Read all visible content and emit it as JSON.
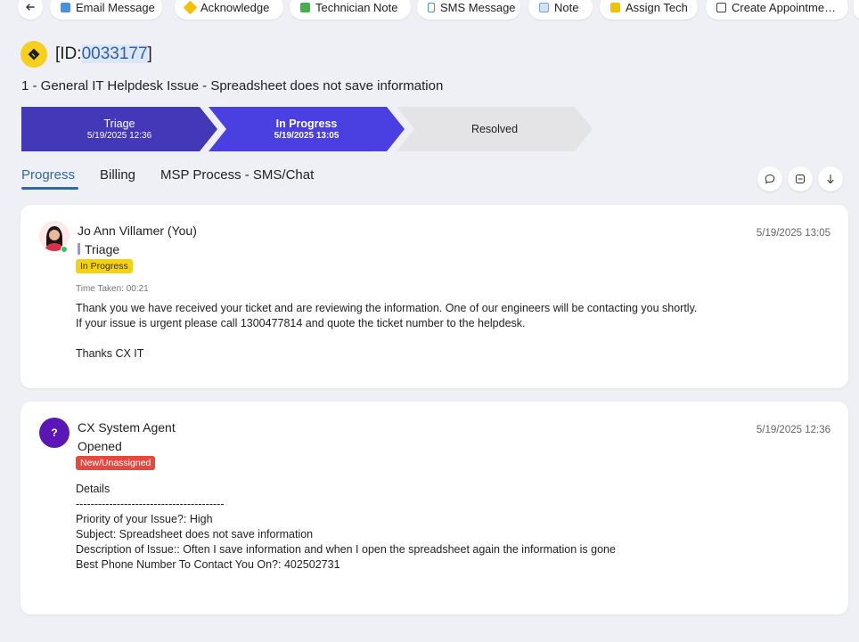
{
  "toolbar": {
    "buttons": [
      {
        "label": "Email Message",
        "icon": "email-icon",
        "color": "#4a90d9"
      },
      {
        "label": "Acknowledge",
        "icon": "acknowledge-icon",
        "color": "#f2c200"
      },
      {
        "label": "Technician Note",
        "icon": "technician-note-icon",
        "color": "#47b04b"
      },
      {
        "label": "SMS Message",
        "icon": "sms-icon",
        "color": "#4a90d9"
      },
      {
        "label": "Note",
        "icon": "note-icon",
        "color": "#6fa8e0"
      },
      {
        "label": "Assign Tech",
        "icon": "assign-tech-icon",
        "color": "#f2c200"
      },
      {
        "label": "Create Appointme…",
        "icon": "calendar-icon",
        "color": "#444444"
      }
    ]
  },
  "ticket": {
    "id_prefix": "[ID:",
    "id_number": "0033177",
    "id_suffix": "]",
    "title": "1 - General IT Helpdesk Issue - Spreadsheet does not save information"
  },
  "stages": [
    {
      "name": "Triage",
      "date": "5/19/2025 12:36"
    },
    {
      "name": "In Progress",
      "date": "5/19/2025 13:05"
    },
    {
      "name": "Resolved",
      "date": ""
    }
  ],
  "tabs": [
    "Progress",
    "Billing",
    "MSP Process - SMS/Chat"
  ],
  "entries": [
    {
      "author": "Jo Ann Villamer (You)",
      "stage": "Triage",
      "badge": "In Progress",
      "badge_color": "#f5d20f",
      "time_taken": "Time Taken: 00:21",
      "timestamp": "5/19/2025 13:05",
      "body": "Thank you we have received your ticket and are reviewing the information. One of our engineers will be contacting you shortly.\nIf your issue is urgent please call 1300477814 and quote the ticket number to the helpdesk.\n\nThanks CX IT"
    },
    {
      "author": "CX System Agent",
      "avatar_text": "?",
      "stage": "Opened",
      "badge": "New/Unassigned",
      "badge_color": "#e5483f",
      "timestamp": "5/19/2025 12:36",
      "body": "Details\n----------------------------------------\nPriority of your Issue?: High\nSubject: Spreadsheet does not save information\nDescription of Issue:: Often I save information and when I open the spreadsheet again the information is gone\nBest Phone Number To Contact You On?: 402502731"
    }
  ]
}
